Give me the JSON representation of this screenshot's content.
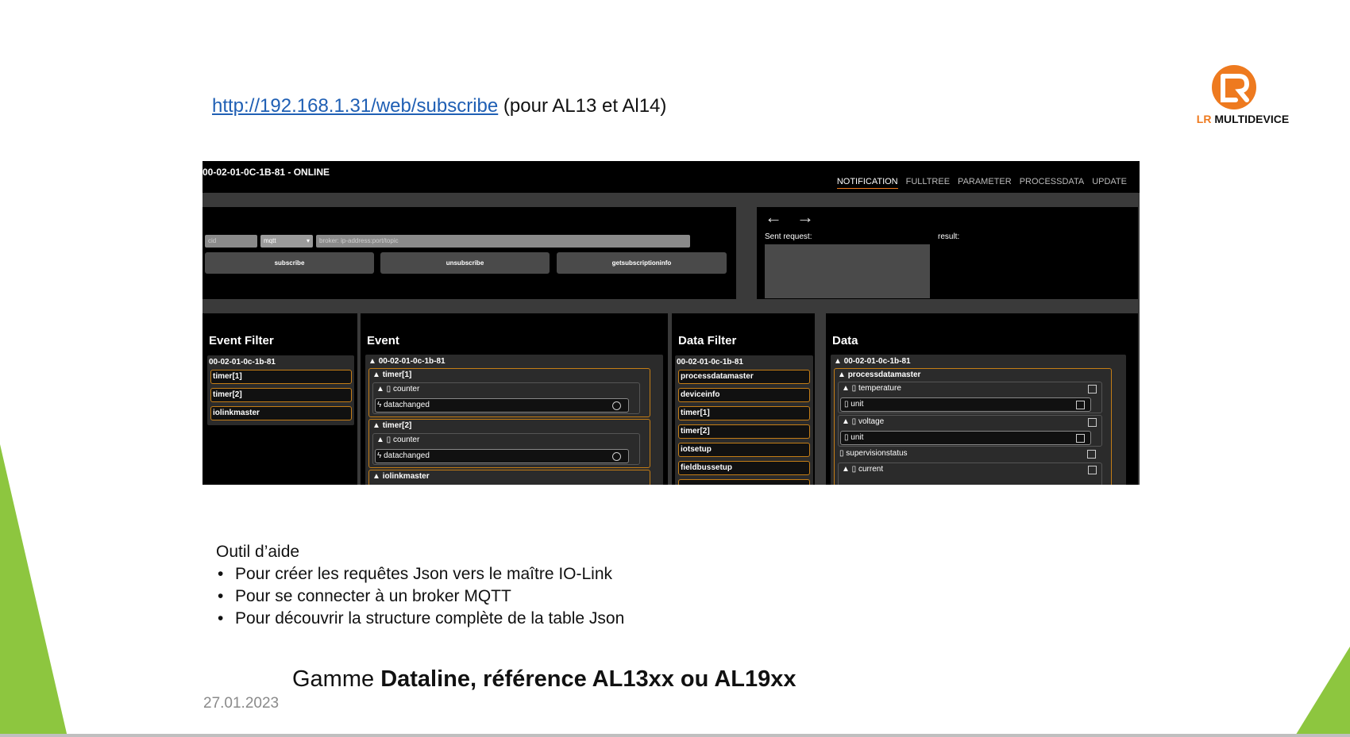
{
  "slide": {
    "url_link": "http://192.168.1.31/web/subscribe",
    "url_suffix": " (pour AL13 et Al14)",
    "logo": {
      "mark": "LR",
      "brand_lr": "LR",
      "brand_rest": " MULTIDEVICE"
    },
    "help_title": "Outil d’aide",
    "help_items": [
      "Pour créer les requêtes Json vers le maître IO-Link",
      "Pour se connecter à un broker MQTT",
      "Pour découvrir la structure complète de la table Json"
    ],
    "gamme_prefix": "Gamme ",
    "gamme_bold": "Dataline, référence AL13xx ou AL19xx",
    "date": "27.01.2023",
    "colors": {
      "accent_green": "#8dc63f",
      "brand_orange": "#ee7a1f",
      "link_blue": "#1f5fb4"
    }
  },
  "app": {
    "device_title": "00-02-01-0C-1B-81 - ONLINE",
    "nav": [
      "NOTIFICATION",
      "FULLTREE",
      "PARAMETER",
      "PROCESSDATA",
      "UPDATE"
    ],
    "active_tab": "NOTIFICATION",
    "request": {
      "cid_placeholder": "cid",
      "protocol_value": "mqtt",
      "broker_placeholder": "broker: ip-address:port/topic",
      "buttons": [
        "subscribe",
        "unsubscribe",
        "getsubscriptioninfo"
      ]
    },
    "response": {
      "back_arrow": "←",
      "forward_arrow": "→",
      "sent_label": "Sent request:",
      "result_label": "result:"
    },
    "event_filter": {
      "title": "Event Filter",
      "device": "00-02-01-0c-1b-81",
      "items": [
        "timer[1]",
        "timer[2]",
        "iolinkmaster"
      ]
    },
    "event": {
      "title": "Event",
      "device": "00-02-01-0c-1b-81",
      "timer1": "timer[1]",
      "timer2": "timer[2]",
      "counter": "counter",
      "datachanged": "datachanged",
      "iolinkmaster": "iolinkmaster"
    },
    "data_filter": {
      "title": "Data Filter",
      "device": "00-02-01-0c-1b-81",
      "items": [
        "processdatamaster",
        "deviceinfo",
        "timer[1]",
        "timer[2]",
        "iotsetup",
        "fieldbussetup"
      ]
    },
    "data": {
      "title": "Data",
      "device": "00-02-01-0c-1b-81",
      "group": "processdatamaster",
      "temperature": "temperature",
      "unit": "unit",
      "voltage": "voltage",
      "supervisionstatus": "supervisionstatus",
      "current": "current"
    }
  }
}
